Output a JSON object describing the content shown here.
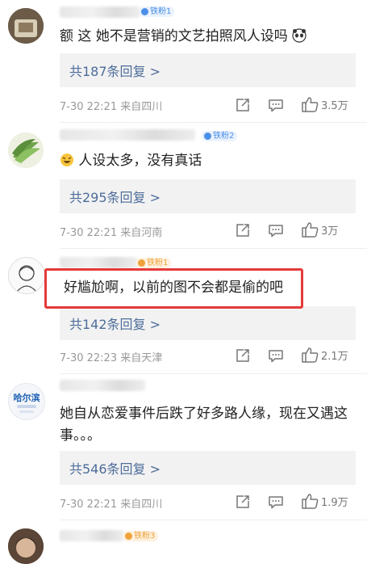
{
  "comments": [
    {
      "badge": "铁粉1",
      "text": "额 这 她不是营销的文艺拍照风人设吗",
      "replies": "共187条回复 >",
      "time": "7-30 22:21 来自四川",
      "likes": "3.5万"
    },
    {
      "badge": "铁粉2",
      "text": "人设太多，没有真话",
      "replies": "共295条回复 >",
      "time": "7-30 22:21 来自河南",
      "likes": "3万"
    },
    {
      "badge": "铁粉1",
      "text": "好尴尬啊，以前的图不会都是偷的吧",
      "replies": "共142条回复 >",
      "time": "7-30 22:23 来自天津",
      "likes": "2.1万"
    },
    {
      "avatar_text": "哈尔滨",
      "text": "她自从恋爱事件后跌了好多路人缘，现在又遇这事。。。",
      "replies": "共546条回复 >",
      "time": "7-30 22:21 来自四川",
      "likes": "1.9万"
    },
    {
      "badge": "铁粉3"
    }
  ],
  "colors": {
    "reply_link": "#4d6d9a",
    "highlight_border": "#e53a3a",
    "badge_blue": "#4b8fe8",
    "badge_orange": "#f0a23a"
  }
}
